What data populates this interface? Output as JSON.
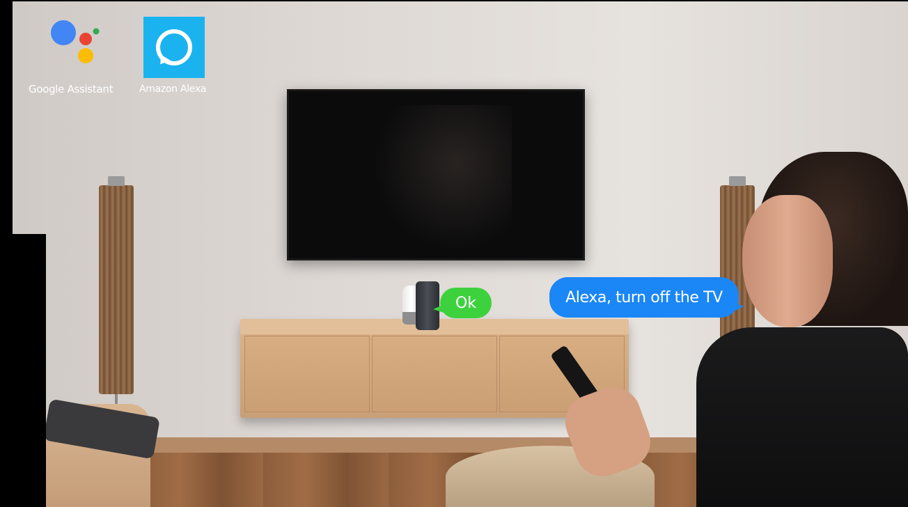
{
  "logos": {
    "google": {
      "label": "Google Assistant",
      "icon": "google-assistant-icon",
      "colors": {
        "blue": "#4285f4",
        "red": "#ea4335",
        "yellow": "#fbbc05",
        "green": "#34a853"
      }
    },
    "alexa": {
      "label": "Amazon Alexa",
      "icon": "amazon-alexa-icon",
      "color": "#1ab3f0"
    }
  },
  "bubbles": {
    "device_reply": {
      "text": "Ok",
      "color": "#3ed13e"
    },
    "user_command": {
      "text": "Alexa, turn off the TV",
      "color": "#1b86f6"
    }
  }
}
